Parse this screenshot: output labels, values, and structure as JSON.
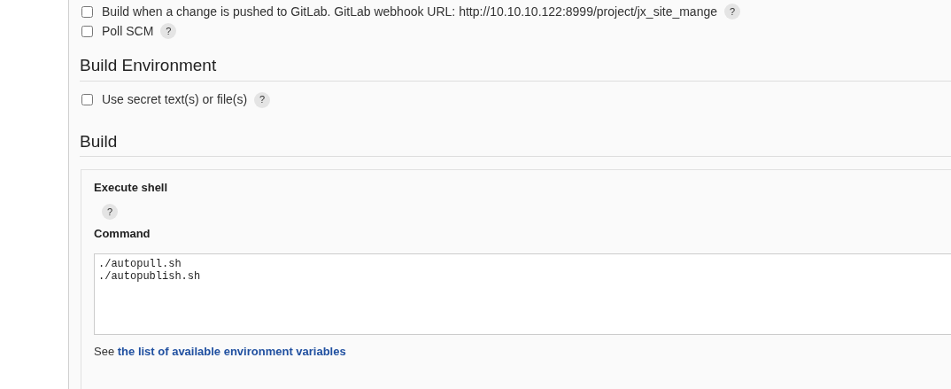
{
  "triggers": [
    {
      "label": "Build when a change is pushed to GitLab. GitLab webhook URL: http://10.10.10.122:8999/project/jx_site_mange",
      "checked": false,
      "help": "?"
    },
    {
      "label": "Poll SCM",
      "checked": false,
      "help": "?"
    }
  ],
  "build_environment": {
    "heading": "Build Environment",
    "options": [
      {
        "label": "Use secret text(s) or file(s)",
        "checked": false,
        "help": "?"
      }
    ]
  },
  "build": {
    "heading": "Build",
    "step": {
      "title": "Execute shell",
      "help": "?",
      "field_label": "Command",
      "command": "./autopull.sh\n./autopublish.sh",
      "note": "See",
      "link": "the list of available environment variables"
    }
  }
}
